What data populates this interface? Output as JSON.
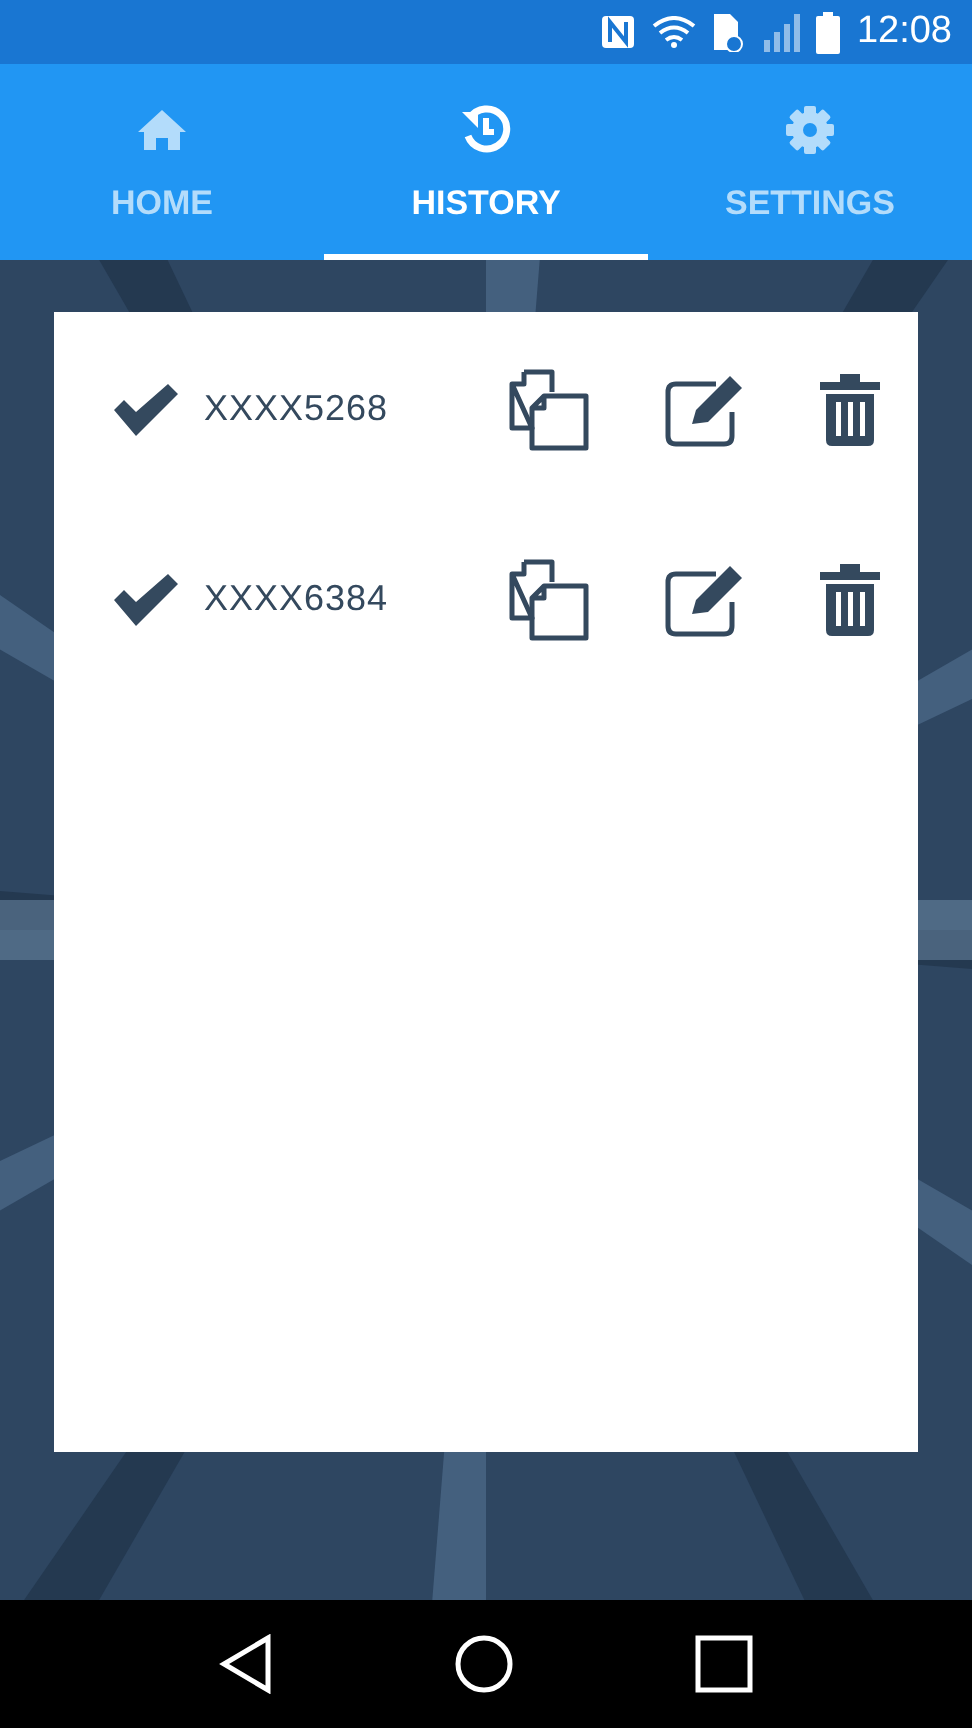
{
  "status_bar": {
    "time": "12:08"
  },
  "tabs": [
    {
      "label": "HOME",
      "kind": "home",
      "selected": false
    },
    {
      "label": "HISTORY",
      "kind": "history",
      "selected": true
    },
    {
      "label": "SETTINGS",
      "kind": "settings",
      "selected": false
    }
  ],
  "history": [
    {
      "number": "XXXX5268"
    },
    {
      "number": "XXXX6384"
    }
  ]
}
